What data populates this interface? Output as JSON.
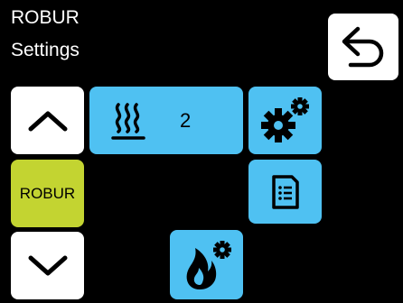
{
  "header": {
    "title": "ROBUR",
    "subtitle": "Settings"
  },
  "navigation": {
    "back_icon": "back-arrow-icon",
    "up_icon": "chevron-up-icon",
    "down_icon": "chevron-down-icon",
    "robur_label": "ROBUR"
  },
  "heating": {
    "icon": "heating-waves-icon",
    "value": "2"
  },
  "tiles": {
    "settings_icon": "gears-icon",
    "report_icon": "document-list-icon",
    "flame_icon": "flame-settings-icon"
  },
  "colors": {
    "background": "#000000",
    "tile_blue": "#4fc1f2",
    "tile_white": "#ffffff",
    "tile_lime": "#c3d431"
  }
}
